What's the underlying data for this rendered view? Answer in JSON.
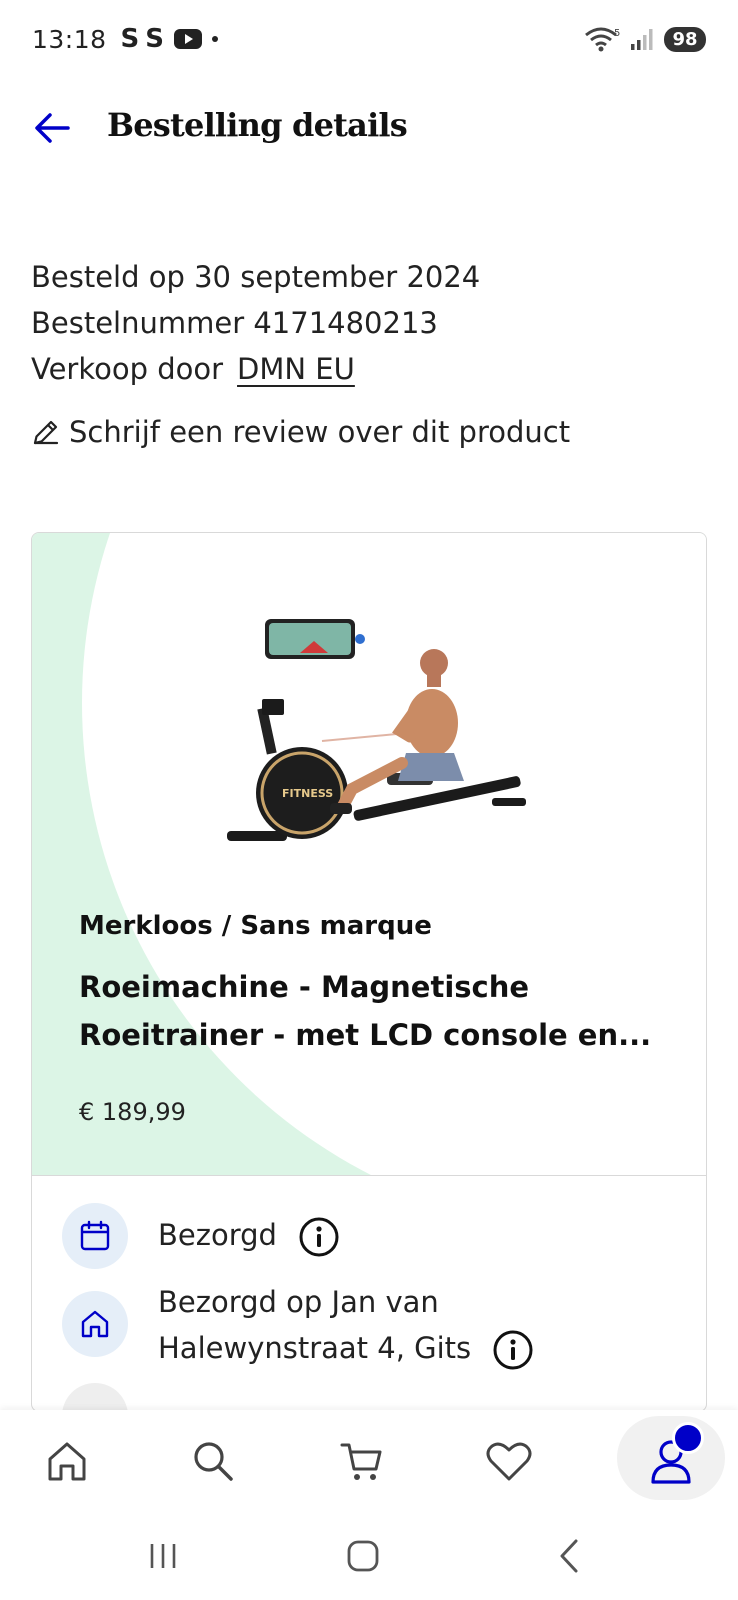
{
  "status_bar": {
    "time": "13:18",
    "app_icons": [
      "S",
      "S"
    ],
    "battery": "98",
    "wifi_badge": "5"
  },
  "header": {
    "title": "Bestelling details",
    "accent_color": "#0000c8"
  },
  "order": {
    "ordered_on": "Besteld op 30 september 2024",
    "order_number": "Bestelnummer 4171480213",
    "sold_by_label": "Verkoop door",
    "seller": "DMN EU",
    "review_link": "Schrijf een review over dit product"
  },
  "product": {
    "image_label": "FITNESS",
    "brand": "Merkloos / Sans marque",
    "title": "Roeimachine - Magnetische Roeitrainer - met LCD console en...",
    "price": "€ 189,99",
    "hero_color": "#dcf5e6"
  },
  "delivery": [
    {
      "icon": "calendar-icon",
      "text": "Bezorgd"
    },
    {
      "icon": "home-icon",
      "text": "Bezorgd op Jan van Halewynstraat 4, Gits"
    }
  ],
  "bottom_nav": [
    "home",
    "search",
    "cart",
    "wishlist",
    "account"
  ]
}
